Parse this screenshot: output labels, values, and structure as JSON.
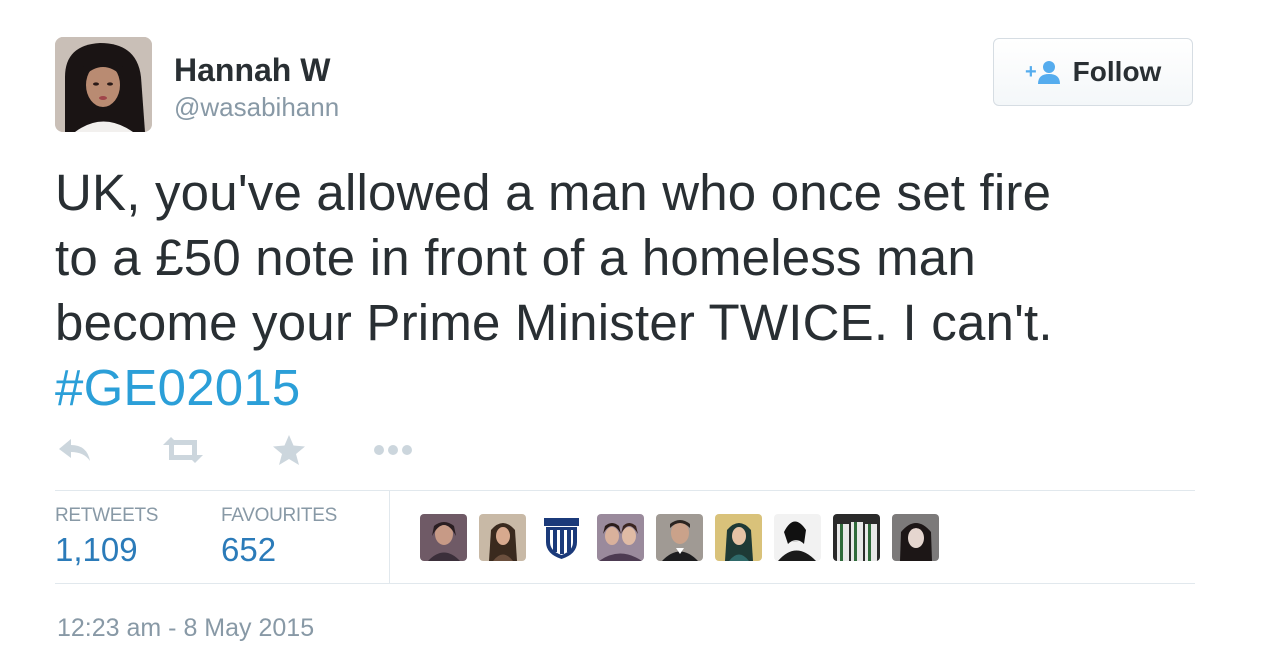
{
  "user": {
    "name": "Hannah W",
    "handle": "@wasabihann"
  },
  "follow_button": {
    "label": "Follow",
    "icon": "add-user-icon"
  },
  "tweet": {
    "lines": [
      "UK, you've allowed a man who once set fire",
      "to a £50 note in front of a homeless man",
      "become your Prime Minister TWICE. I can't."
    ],
    "hashtag": "#GE02015"
  },
  "actions": [
    {
      "name": "reply",
      "icon": "reply-icon"
    },
    {
      "name": "retweet",
      "icon": "retweet-icon"
    },
    {
      "name": "favourite",
      "icon": "star-icon"
    },
    {
      "name": "more",
      "icon": "more-icon"
    }
  ],
  "stats": {
    "retweets_label": "RETWEETS",
    "retweets_value": "1,109",
    "favourites_label": "FAVOURITES",
    "favourites_value": "652"
  },
  "favourited_by_avatars": 9,
  "timestamp": "12:23 am - 8 May 2015",
  "colors": {
    "link": "#2b9fd8",
    "stat_value": "#2b7bb9",
    "muted": "#8899a6",
    "text": "#292f33",
    "icon_gray": "#ccd6dd"
  }
}
